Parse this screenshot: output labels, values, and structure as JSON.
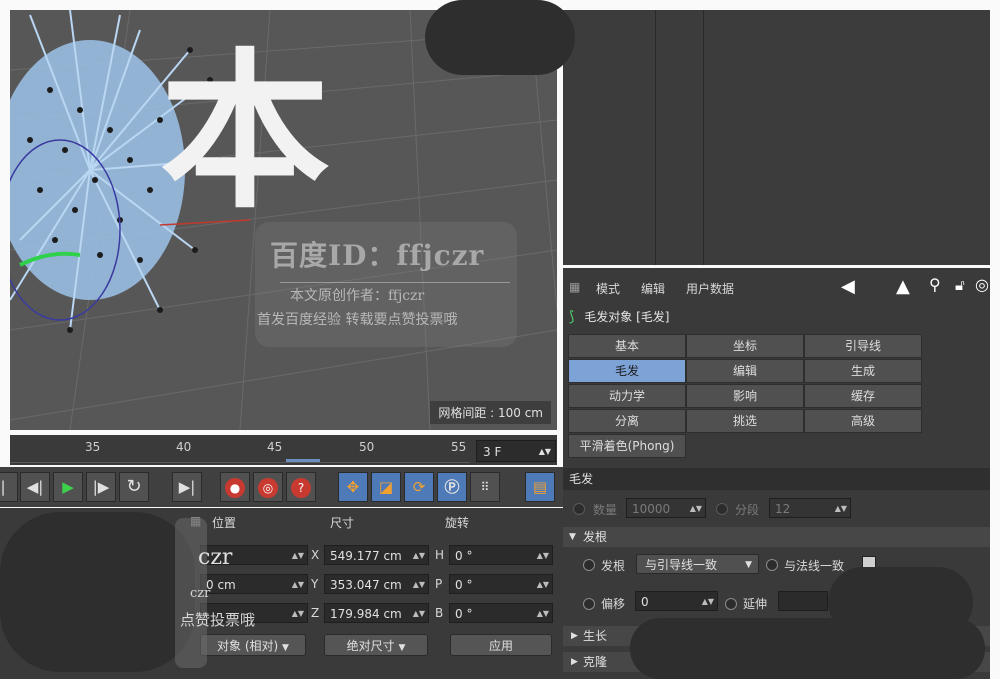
{
  "viewport": {
    "grid_spacing": "网格间距 : 100 cm",
    "big_char": "本"
  },
  "watermark": {
    "id_line": "百度ID：ffjczr",
    "author_line": "本文原创作者：ffjczr",
    "slogan": "首发百度经验  转载要点赞投票哦",
    "partial_id": "czr",
    "partial_id2": "czr",
    "partial_slogan": "点赞投票哦"
  },
  "timeline": {
    "ticks": [
      "35",
      "40",
      "45",
      "50",
      "55"
    ],
    "frame": "3 F"
  },
  "attributes": {
    "menu": [
      "模式",
      "编辑",
      "用户数据"
    ],
    "object_title": "毛发对象 [毛发]",
    "tabs": [
      [
        "基本",
        "坐标",
        "引导线"
      ],
      [
        "毛发",
        "编辑",
        "生成"
      ],
      [
        "动力学",
        "影响",
        "缓存"
      ],
      [
        "分离",
        "挑选",
        "高级"
      ]
    ],
    "active_tab": "毛发",
    "extra_tab": "平滑着色(Phong)",
    "section": "毛发",
    "count_label": "数量",
    "count_value": "10000",
    "segments_label": "分段",
    "segments_value": "12",
    "root_header": "发根",
    "root_label": "发根",
    "root_option": "与引导线一致",
    "normal_label": "与法线一致",
    "offset_label": "偏移",
    "offset_value": "0",
    "extend_label": "延伸",
    "grow_header": "生长",
    "clone_header": "克隆"
  },
  "coords": {
    "headers": [
      "位置",
      "尺寸",
      "旋转"
    ],
    "rows": [
      {
        "axis": "X",
        "size": "549.177 cm",
        "rot_axis": "H",
        "rot": "0 °"
      },
      {
        "axis": "Y",
        "pos": "0 cm",
        "size": "353.047 cm",
        "rot_axis": "P",
        "rot": "0 °"
      },
      {
        "axis": "Z",
        "size": "179.984 cm",
        "rot_axis": "B",
        "rot": "0 °"
      }
    ],
    "mode_dropdown": "对象 (相对)",
    "size_dropdown": "绝对尺寸",
    "apply_button": "应用"
  }
}
